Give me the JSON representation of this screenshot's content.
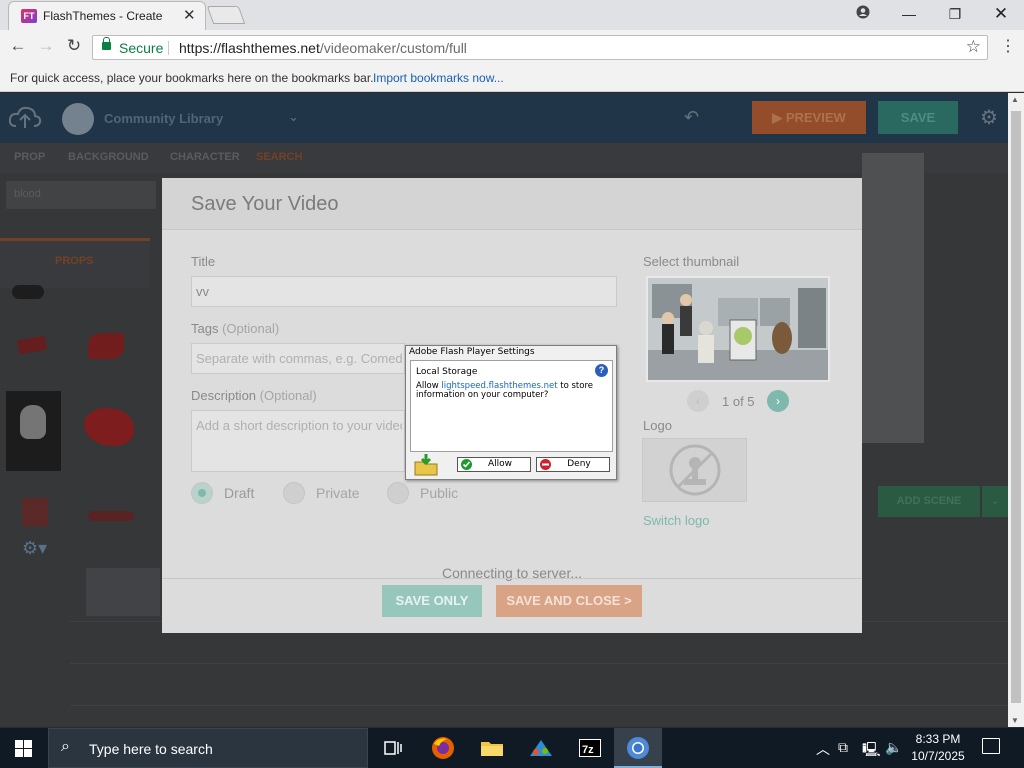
{
  "browser": {
    "tab_title": "FlashThemes - Create",
    "secure_label": "Secure",
    "url_host": "https://flashthemes.net",
    "url_path": "/videomaker/custom/full",
    "bookmarks_text": "For quick access, place your bookmarks here on the bookmarks bar.",
    "bookmarks_link": "Import bookmarks now..."
  },
  "app": {
    "library_label": "Community Library",
    "preview_label": "PREVIEW",
    "save_label": "SAVE",
    "asset_tabs": [
      "PROP",
      "BACKGROUND",
      "CHARACTER",
      "SEARCH"
    ],
    "search_value": "blood",
    "props_label": "PROPS",
    "add_scene_label": "ADD SCENE"
  },
  "modal": {
    "title": "Save Your Video",
    "title_label": "Title",
    "title_value": "vv",
    "tags_label": "Tags",
    "tags_optional": "(Optional)",
    "tags_placeholder": "Separate with commas, e.g. Comedy",
    "description_label": "Description",
    "description_optional": "(Optional)",
    "description_placeholder": "Add a short description to your video",
    "privacy_options": [
      "Draft",
      "Private",
      "Public"
    ],
    "selected_privacy": "Draft",
    "thumbnail_label": "Select thumbnail",
    "thumbnail_pager": "1 of 5",
    "logo_label": "Logo",
    "switch_logo": "Switch logo",
    "status": "Connecting to server...",
    "save_only": "SAVE ONLY",
    "save_and_close": "SAVE AND CLOSE >"
  },
  "flash_dialog": {
    "title": "Adobe Flash Player Settings",
    "section": "Local Storage",
    "msg_prefix": "Allow ",
    "msg_domain": "lightspeed.flashthemes.net",
    "msg_suffix": " to store information on your computer?",
    "allow": "Allow",
    "deny": "Deny"
  },
  "taskbar": {
    "search_placeholder": "Type here to search",
    "time": "8:33 PM",
    "date": "10/7/2025"
  }
}
